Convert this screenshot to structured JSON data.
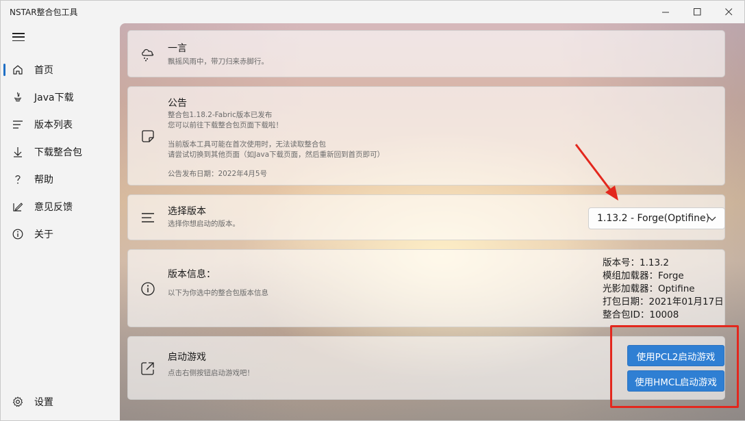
{
  "window": {
    "title": "NSTAR整合包工具",
    "controls": {
      "minimize": "—",
      "maximize": "☐",
      "close": "✕"
    }
  },
  "sidebar": {
    "menu_icon": "hamburger-icon",
    "items": [
      {
        "label": "首页",
        "icon": "home-icon",
        "active": true
      },
      {
        "label": "Java下载",
        "icon": "java-icon"
      },
      {
        "label": "版本列表",
        "icon": "list-icon"
      },
      {
        "label": "下载整合包",
        "icon": "download-icon"
      },
      {
        "label": "帮助",
        "icon": "question-icon"
      },
      {
        "label": "意见反馈",
        "icon": "feedback-icon"
      },
      {
        "label": "关于",
        "icon": "info-icon"
      }
    ],
    "settings_label": "设置"
  },
  "cards": {
    "quote": {
      "title": "一言",
      "subtitle": "飘摇风雨中，带刀归来赤脚行。"
    },
    "notice": {
      "title": "公告",
      "lines": [
        "整合包1.18.2-Fabric版本已发布",
        "您可以前往下载整合包页面下载啦！",
        "",
        "当前版本工具可能在首次使用时，无法读取整合包",
        "请尝试切换到其他页面（如Java下载页面，然后重新回到首页即可）",
        "",
        "公告发布日期：2022年4月5号"
      ]
    },
    "version_select": {
      "title": "选择版本",
      "subtitle": "选择你想启动的版本。",
      "selected": "1.13.2 - Forge(Optifine)"
    },
    "version_info": {
      "title": "版本信息：",
      "subtitle": "以下为你选中的整合包版本信息",
      "details": [
        "版本号：1.13.2",
        "模组加载器：Forge",
        "光影加载器：Optifine",
        "打包日期：2021年01月17日",
        "整合包ID：10008"
      ]
    },
    "launch": {
      "title": "启动游戏",
      "subtitle": "点击右侧按钮启动游戏吧！",
      "pcl2_button": "使用PCL2启动游戏",
      "hmcl_button": "使用HMCL启动游戏"
    }
  },
  "colors": {
    "accent": "#2f7fd3",
    "annotation": "#e3271d"
  }
}
